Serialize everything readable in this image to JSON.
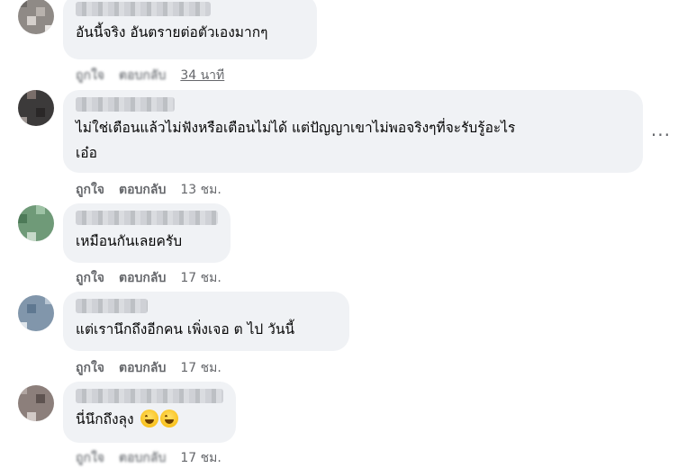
{
  "comments": [
    {
      "text": "อันนี้จริง อันตรายต่อตัวเองมากๆ",
      "like": "ถูกใจ",
      "reply": "ตอบกลับ",
      "time": "34 นาที"
    },
    {
      "text": "ไม่ใช่เตือนแล้วไม่ฟังหรือเตือนไม่ได้ แต่ปัญญาเขาไม่พอจริงๆที่จะรับรู้อะไร\nเอ๋อ",
      "like": "ถูกใจ",
      "reply": "ตอบกลับ",
      "time": "13 ชม.",
      "more": "···"
    },
    {
      "text": "เหมือนกันเลยครับ",
      "like": "ถูกใจ",
      "reply": "ตอบกลับ",
      "time": "17 ชม."
    },
    {
      "text": "แต่เรานึกถึงอีกคน เพิ่งเจอ ต ไป วันนี้",
      "like": "ถูกใจ",
      "reply": "ตอบกลับ",
      "time": "17 ชม."
    },
    {
      "text": "นี่นึกถึงลุง",
      "like": "ถูกใจ",
      "reply": "ตอบกลับ",
      "time": "17 ชม."
    }
  ],
  "colors": {
    "bubble": "#f0f2f5",
    "meta": "#65676b"
  },
  "icons": {
    "reaction": "grinning-face-emoji"
  }
}
